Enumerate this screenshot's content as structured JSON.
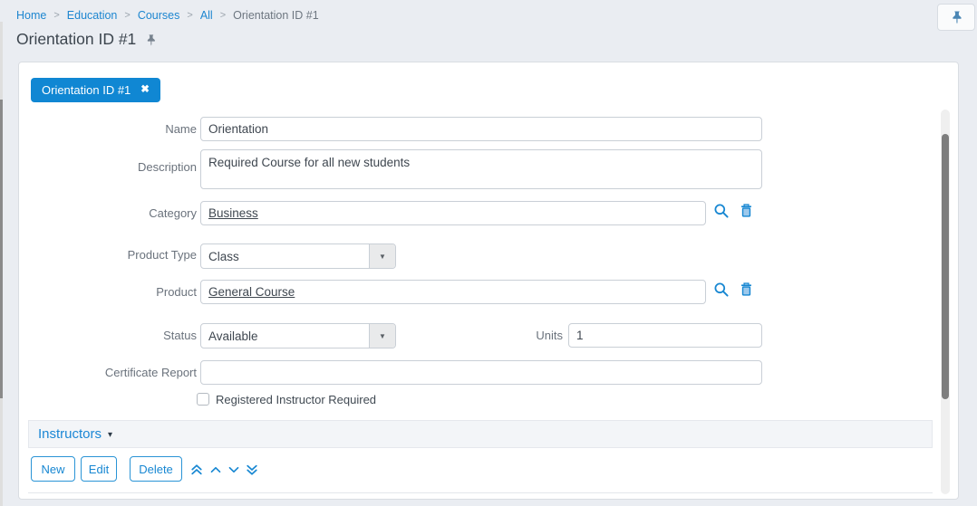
{
  "colors": {
    "accent_blue": "#1087d3",
    "link_blue": "#1d86d0",
    "page_background": "#eaedf2",
    "label_gray": "#6a727c"
  },
  "breadcrumb": {
    "separator": ">",
    "items": [
      {
        "label": "Home"
      },
      {
        "label": "Education"
      },
      {
        "label": "Courses"
      },
      {
        "label": "All"
      },
      {
        "label": "Orientation ID #1"
      }
    ]
  },
  "header": {
    "title": "Orientation ID #1",
    "pin_icon": "pushpin"
  },
  "record_tab": {
    "label": "Orientation ID #1",
    "close_glyph": "✖"
  },
  "form": {
    "name": {
      "label": "Name",
      "value": "Orientation"
    },
    "description": {
      "label": "Description",
      "value": "Required Course for all new students"
    },
    "category": {
      "label": "Category",
      "value": "Business"
    },
    "product_type": {
      "label": "Product Type",
      "value": "Class"
    },
    "product": {
      "label": "Product",
      "value": "General Course"
    },
    "status": {
      "label": "Status",
      "value": "Available"
    },
    "units": {
      "label": "Units",
      "value": "1"
    },
    "certificate_report": {
      "label": "Certificate Report",
      "value": ""
    },
    "registered_instructor_required": {
      "label": "Registered Instructor Required",
      "checked": false
    }
  },
  "sections": {
    "instructors": {
      "title": "Instructors",
      "caret_glyph": "▾"
    }
  },
  "toolbar": {
    "new_label": "New",
    "edit_label": "Edit",
    "delete_label": "Delete",
    "icons": [
      "move-top-icon",
      "move-up-icon",
      "move-down-icon",
      "move-bottom-icon"
    ]
  },
  "glyphs": {
    "select_caret": "▼",
    "search_icon": "magnifier",
    "delete_icon": "trash"
  }
}
